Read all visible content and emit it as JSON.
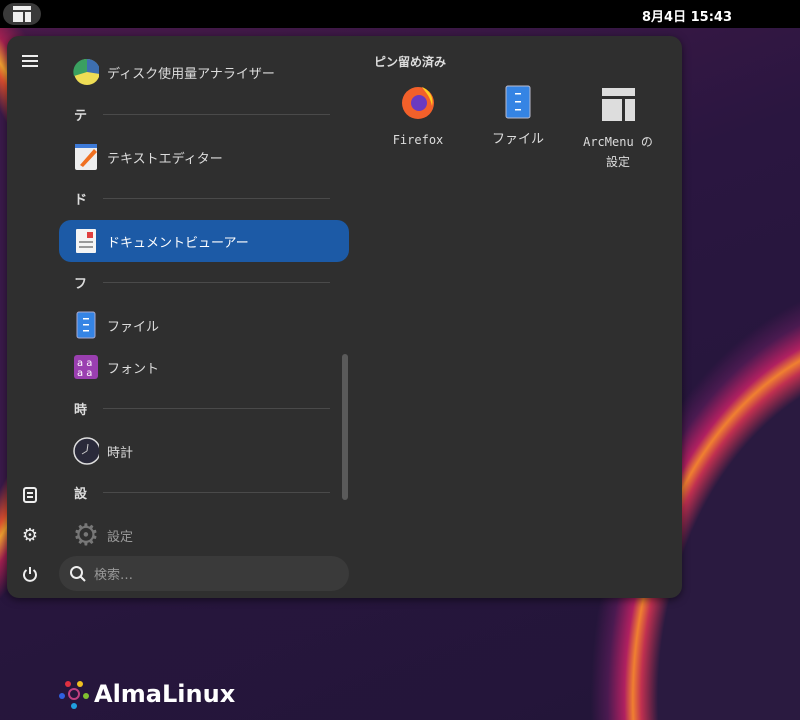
{
  "topbar": {
    "clock": "8月4日 15:43"
  },
  "menu": {
    "items": [
      {
        "type": "app",
        "label": "ディスク使用量アナライザー",
        "icon": "disk-usage-icon"
      },
      {
        "type": "header",
        "label": "テ"
      },
      {
        "type": "app",
        "label": "テキストエディター",
        "icon": "text-editor-icon"
      },
      {
        "type": "header",
        "label": "ド"
      },
      {
        "type": "app",
        "label": "ドキュメントビューアー",
        "icon": "document-viewer-icon",
        "active": true
      },
      {
        "type": "header",
        "label": "フ"
      },
      {
        "type": "app",
        "label": "ファイル",
        "icon": "files-icon"
      },
      {
        "type": "app",
        "label": "フォント",
        "icon": "fonts-icon"
      },
      {
        "type": "header",
        "label": "時"
      },
      {
        "type": "app",
        "label": "時計",
        "icon": "clock-icon"
      },
      {
        "type": "header",
        "label": "設"
      },
      {
        "type": "app",
        "label": "設定",
        "icon": "settings-icon"
      }
    ],
    "search_placeholder": "検索…",
    "pinned_title": "ピン留め済み",
    "pinned": [
      {
        "label": "Firefox",
        "icon": "firefox-icon"
      },
      {
        "label": "ファイル",
        "icon": "files-icon"
      },
      {
        "label": "ArcMenu の\n設定",
        "label_1": "ArcMenu の",
        "label_2": "設定",
        "icon": "arcmenu-icon"
      }
    ]
  },
  "desktop": {
    "logo_text": "AlmaLinux"
  },
  "colors": {
    "accent": "#1c5aa6",
    "panel": "#2f2f2f"
  }
}
